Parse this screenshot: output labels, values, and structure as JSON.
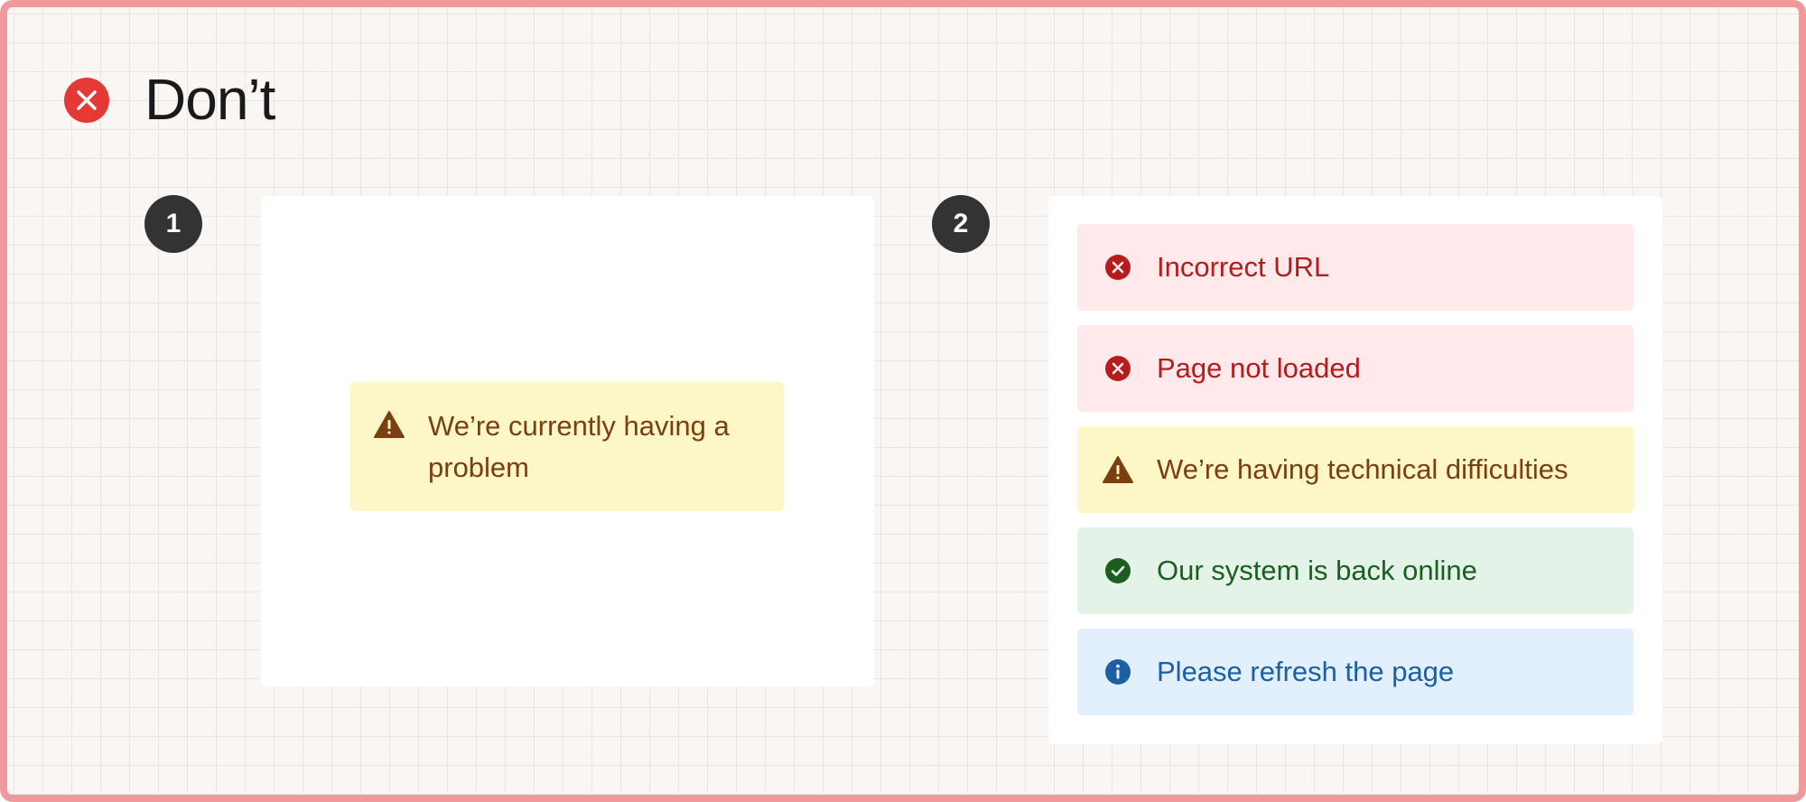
{
  "header": {
    "title": "Don’t",
    "icon": "error-x-icon",
    "icon_color": "#e53935"
  },
  "colors": {
    "frame_border": "#ef9a9a",
    "background": "#faf6f3",
    "badge": "#333333",
    "error_bg": "#ffe9ea",
    "error_text": "#b71c1c",
    "warning_bg": "#fdf6c6",
    "warning_text": "#7b3f10",
    "success_bg": "#e3f3e8",
    "success_text": "#1b5e20",
    "info_bg": "#e1f0fc",
    "info_text": "#1e5fa3"
  },
  "example1": {
    "badge": "1",
    "alert": {
      "type": "warning",
      "icon": "warning-triangle-icon",
      "text": "We’re currently having a problem"
    }
  },
  "example2": {
    "badge": "2",
    "alerts": [
      {
        "type": "error",
        "icon": "error-circle-icon",
        "text": "Incorrect URL"
      },
      {
        "type": "error",
        "icon": "error-circle-icon",
        "text": "Page not loaded"
      },
      {
        "type": "warning",
        "icon": "warning-triangle-icon",
        "text": "We’re having technical difficulties"
      },
      {
        "type": "success",
        "icon": "check-circle-icon",
        "text": "Our system is back online"
      },
      {
        "type": "info",
        "icon": "info-circle-icon",
        "text": "Please refresh the page"
      }
    ]
  }
}
